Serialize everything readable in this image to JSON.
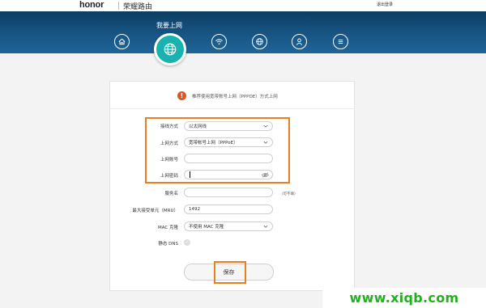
{
  "header": {
    "brand": "honor",
    "subtitle": "荣耀路由",
    "logout": "退出登录"
  },
  "nav": {
    "current_label": "我要上网",
    "items": [
      {
        "icon": "home-icon"
      },
      {
        "icon": "globe-icon",
        "active": true
      },
      {
        "icon": "wifi-icon"
      },
      {
        "icon": "globe-settings-icon"
      },
      {
        "icon": "user-icon"
      },
      {
        "icon": "menu-icon"
      }
    ]
  },
  "notice": {
    "icon_text": "!",
    "text": "推荐使用宽带账号上网（PPPOE）方式上网"
  },
  "form": {
    "fields": [
      {
        "label": "接线方式",
        "value": "以太网线"
      },
      {
        "label": "上网方式",
        "value": "宽带帐号上网（PPPoE）"
      },
      {
        "label": "上网账号",
        "value": ""
      },
      {
        "label": "上网密码",
        "value": ""
      },
      {
        "label": "服务名",
        "value": ""
      },
      {
        "label": "最大接受单元（MRU）",
        "value": "1492"
      },
      {
        "label": "MAC 克隆",
        "value": "不使用 MAC 克隆"
      },
      {
        "label": "静态 DNS",
        "value": ""
      }
    ],
    "service_hint": "（可不填）",
    "save_label": "保存"
  },
  "watermark": "www.xiqb.com",
  "colors": {
    "nav_band": "#185584",
    "active_nav": "#1ab2b0",
    "highlight": "#e8801f",
    "warning": "#e2541e",
    "watermark": "#21b11f"
  }
}
